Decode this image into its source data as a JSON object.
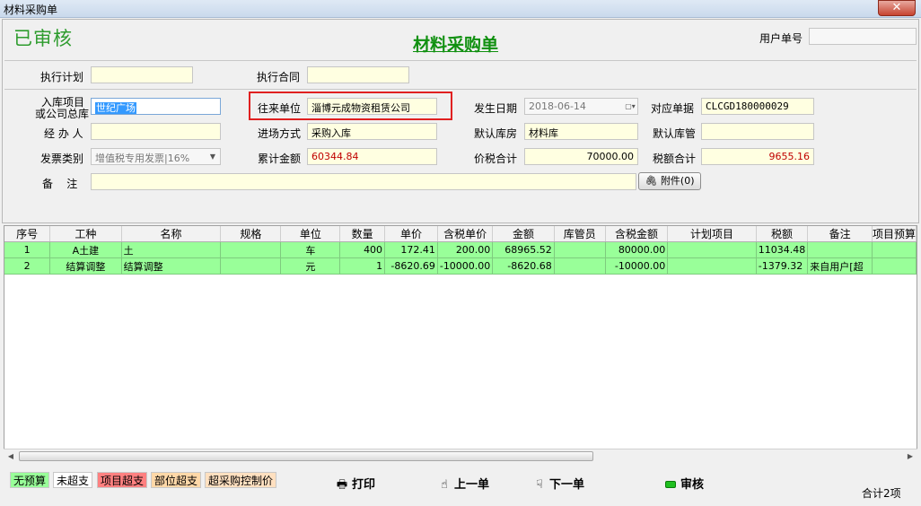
{
  "window": {
    "title": "材料采购单",
    "close": "✕"
  },
  "header": {
    "status": "已审核",
    "doc_title": "材料采购单",
    "user_no_label": "用户单号",
    "user_no_value": ""
  },
  "form": {
    "exec_plan_label": "执行计划",
    "exec_plan_value": "",
    "exec_contract_label": "执行合同",
    "exec_contract_value": "",
    "project_label_1": "入库项目",
    "project_label_2": "或公司总库",
    "project_value": "世纪广场",
    "partner_label": "往来单位",
    "partner_value": "淄博元成物资租赁公司",
    "date_label": "发生日期",
    "date_value": "2018-06-14",
    "ref_label": "对应单据",
    "ref_value": "CLCGD180000029",
    "handler_label": "经 办 人",
    "handler_value": "",
    "entry_mode_label": "进场方式",
    "entry_mode_value": "采购入库",
    "warehouse_label": "默认库房",
    "warehouse_value": "材料库",
    "keeper_label": "默认库管",
    "keeper_value": "",
    "invoice_label": "发票类别",
    "invoice_value": "增值税专用发票|16%",
    "total_label": "累计金额",
    "total_value": "60344.84",
    "tax_price_total_label": "价税合计",
    "tax_price_total_value": "70000.00",
    "tax_total_label": "税额合计",
    "tax_total_value": "9655.16",
    "remark_label": "备    注",
    "remark_value": "",
    "attach_label": "附件(0)"
  },
  "grid": {
    "columns": [
      "序号",
      "工种",
      "名称",
      "规格",
      "单位",
      "数量",
      "单价",
      "含税单价",
      "金额",
      "库管员",
      "含税金额",
      "计划项目",
      "税额",
      "备注",
      "项目预算"
    ],
    "rows": [
      [
        "1",
        "A土建",
        "土",
        "",
        "车",
        "400",
        "172.41",
        "200.00",
        "68965.52",
        "",
        "80000.00",
        "",
        "11034.48",
        "",
        ""
      ],
      [
        "2",
        "结算调整",
        "结算调整",
        "",
        "元",
        "1",
        "-8620.69",
        "-10000.00",
        "-8620.68",
        "",
        "-10000.00",
        "",
        "-1379.32",
        "来自用户[超",
        ""
      ]
    ]
  },
  "legend": [
    {
      "label": "无预算",
      "bg": "#99ff99"
    },
    {
      "label": "未超支",
      "bg": "#ffffff"
    },
    {
      "label": "项目超支",
      "bg": "#ff8080"
    },
    {
      "label": "部位超支",
      "bg": "#ffd8a8"
    },
    {
      "label": "超采购控制价",
      "bg": "#ffe0c0"
    }
  ],
  "toolbar": {
    "print": "打印",
    "prev": "上一单",
    "next": "下一单",
    "approve": "审核"
  },
  "footer": {
    "count": "合计2项"
  },
  "colors": {
    "accent_green": "#109010",
    "row_green": "#99ff99",
    "amount_red": "#c00000",
    "highlight_red": "#e02020"
  }
}
